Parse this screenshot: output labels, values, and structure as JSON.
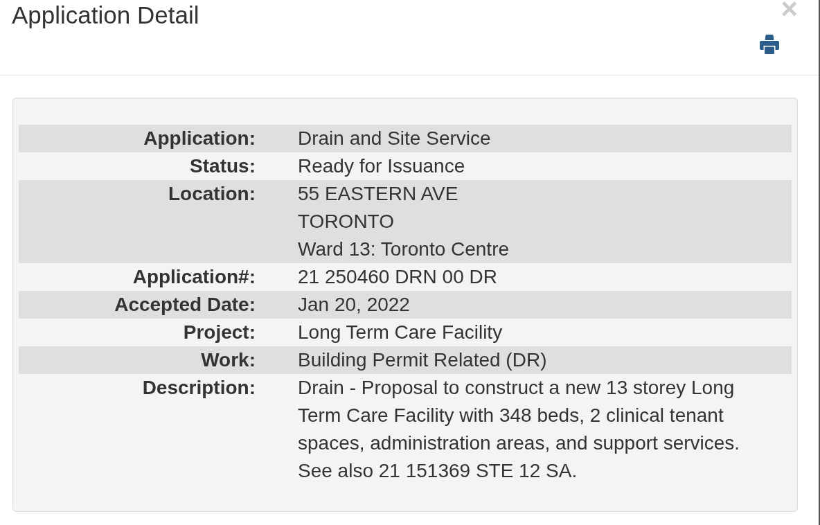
{
  "dialog": {
    "title": "Application Detail",
    "close_button": "×"
  },
  "details": [
    {
      "label": "Application:",
      "lines": [
        "Drain and Site Service"
      ]
    },
    {
      "label": "Status:",
      "lines": [
        "Ready for Issuance"
      ]
    },
    {
      "label": "Location:",
      "lines": [
        "55 EASTERN AVE",
        "TORONTO",
        "Ward 13: Toronto Centre"
      ]
    },
    {
      "label": "Application#:",
      "lines": [
        "21 250460 DRN 00 DR"
      ]
    },
    {
      "label": "Accepted Date:",
      "lines": [
        "Jan 20, 2022"
      ]
    },
    {
      "label": "Project:",
      "lines": [
        "Long Term Care Facility"
      ]
    },
    {
      "label": "Work:",
      "lines": [
        "Building Permit Related (DR)"
      ]
    },
    {
      "label": "Description:",
      "lines": [
        "Drain - Proposal to construct a new 13 storey Long Term Care Facility with 348 beds, 2 clinical tenant spaces, administration areas, and support services. See also 21 151369 STE 12 SA."
      ]
    }
  ]
}
